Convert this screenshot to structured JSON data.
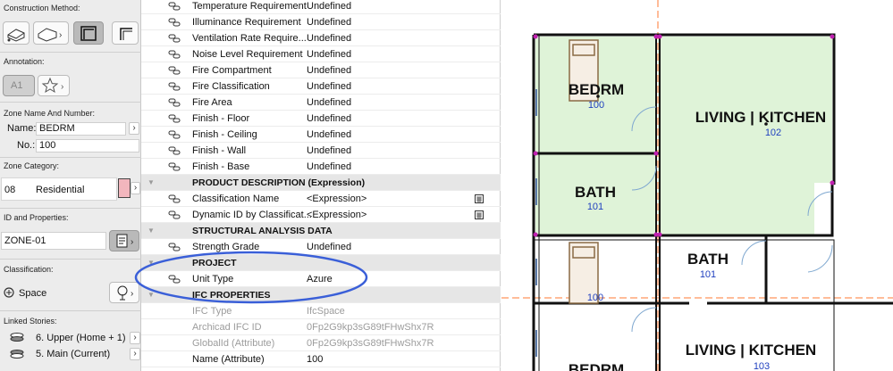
{
  "left_panel": {
    "construction_method_title": "Construction Method:",
    "annotation_title": "Annotation:",
    "annotation_tag": "A1",
    "zone_name_title": "Zone Name And Number:",
    "name_label": "Name:",
    "name_value": "BEDRM",
    "no_label": "No.:",
    "no_value": "100",
    "zone_category_title": "Zone Category:",
    "category_code": "08",
    "category_name": "Residential",
    "category_color": "#f2b6bd",
    "id_props_title": "ID and Properties:",
    "id_value": "ZONE-01",
    "classification_title": "Classification:",
    "classification_value": "Space",
    "linked_stories_title": "Linked Stories:",
    "story_upper": "6. Upper (Home + 1)",
    "story_main": "5. Main (Current)"
  },
  "table": {
    "rows": [
      {
        "name": "Temperature Requirement",
        "value": "Undefined"
      },
      {
        "name": "Illuminance Requirement",
        "value": "Undefined"
      },
      {
        "name": "Ventilation Rate Require...",
        "value": "Undefined"
      },
      {
        "name": "Noise Level Requirement",
        "value": "Undefined"
      },
      {
        "name": "Fire Compartment",
        "value": "Undefined"
      },
      {
        "name": "Fire Classification",
        "value": "Undefined"
      },
      {
        "name": "Fire Area",
        "value": "Undefined"
      },
      {
        "name": "Finish - Floor",
        "value": "Undefined"
      },
      {
        "name": "Finish - Ceiling",
        "value": "Undefined"
      },
      {
        "name": "Finish - Wall",
        "value": "Undefined"
      },
      {
        "name": "Finish - Base",
        "value": "Undefined"
      },
      {
        "name": "PRODUCT DESCRIPTION (Expression)",
        "value": ""
      },
      {
        "name": "Classification Name",
        "value": "<Expression>"
      },
      {
        "name": "Dynamic ID by Classificat...",
        "value": "<Expression>"
      },
      {
        "name": "STRUCTURAL ANALYSIS DATA",
        "value": ""
      },
      {
        "name": "Strength Grade",
        "value": "Undefined"
      },
      {
        "name": "PROJECT",
        "value": ""
      },
      {
        "name": "Unit Type",
        "value": "Azure"
      },
      {
        "name": "IFC PROPERTIES",
        "value": ""
      },
      {
        "name": "IFC Type",
        "value": "IfcSpace"
      },
      {
        "name": "Archicad IFC ID",
        "value": "0Fp2G9kp3sG89tFHwShx7R"
      },
      {
        "name": "GlobalId (Attribute)",
        "value": "0Fp2G9kp3sG89tFHwShx7R"
      },
      {
        "name": "Name (Attribute)",
        "value": "100"
      }
    ]
  },
  "plan": {
    "rooms": [
      {
        "label": "BEDRM",
        "number": "100"
      },
      {
        "label": "LIVING | KITCHEN",
        "number": "102"
      },
      {
        "label": "BATH",
        "number": "101"
      },
      {
        "label": "BATH",
        "number": "101"
      },
      {
        "label": "BEDRM",
        "number": "100"
      },
      {
        "label": "LIVING | KITCHEN",
        "number": "103"
      },
      {
        "label": "BEDRM",
        "number": ""
      }
    ],
    "zone_fill": "#dff3d8",
    "guide_color": "#ff7a33",
    "highlight_color": "#3a5fd8",
    "vertex_color": "#c020b0"
  },
  "icons": {
    "property": "link-icon",
    "calculator": "calculator-icon",
    "doc": "document-icon",
    "tree": "tree-icon",
    "star": "star-icon"
  }
}
